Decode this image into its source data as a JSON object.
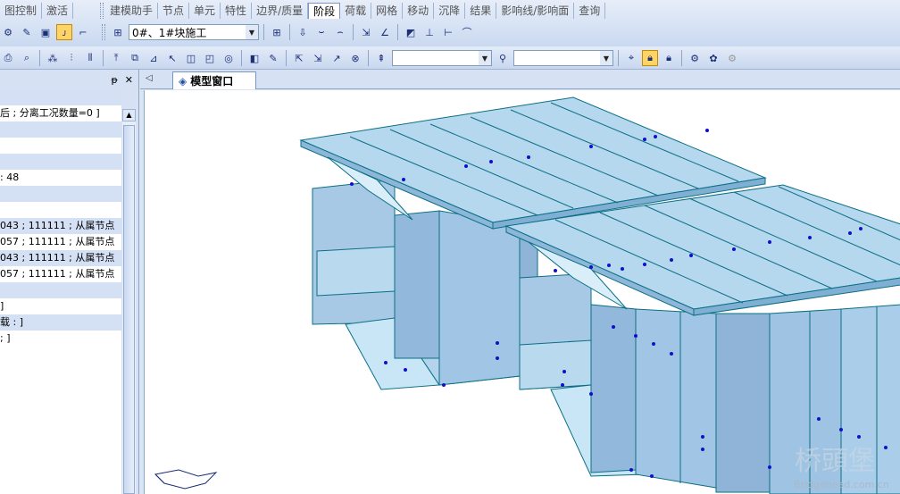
{
  "menu_tabs": [
    "图控制",
    "激活"
  ],
  "main_tabs": [
    "建模助手",
    "节点",
    "单元",
    "特性",
    "边界/质量",
    "阶段",
    "荷载",
    "网格",
    "移动",
    "沉降",
    "结果",
    "影响线/影响面",
    "查询"
  ],
  "active_tab": "阶段",
  "stage_select": "0#、1#块施工",
  "left_pane": {
    "pin_glyph": "ᵽ",
    "close_glyph": "✕",
    "lines": [
      "",
      "后 ; 分离工况数量=0 ]",
      "",
      "",
      "",
      ": 48",
      "",
      "",
      "043 ; 111111 ; 从属节点",
      "057 ; 111111 ; 从属节点",
      "043 ; 111111 ; 从属节点",
      "057 ; 111111 ; 从属节点",
      "",
      "]",
      "载 : ]",
      "; ]"
    ]
  },
  "doc_tab": {
    "label": "模型窗口",
    "nav": "◁"
  },
  "watermark": {
    "cn": "桥頭堡",
    "en": "Bridgehead.com.cn"
  },
  "colors": {
    "face_light": "#b9d9ef",
    "face_mid": "#9fc2e0",
    "edge": "#0b6f85",
    "node": "#1010cc"
  }
}
